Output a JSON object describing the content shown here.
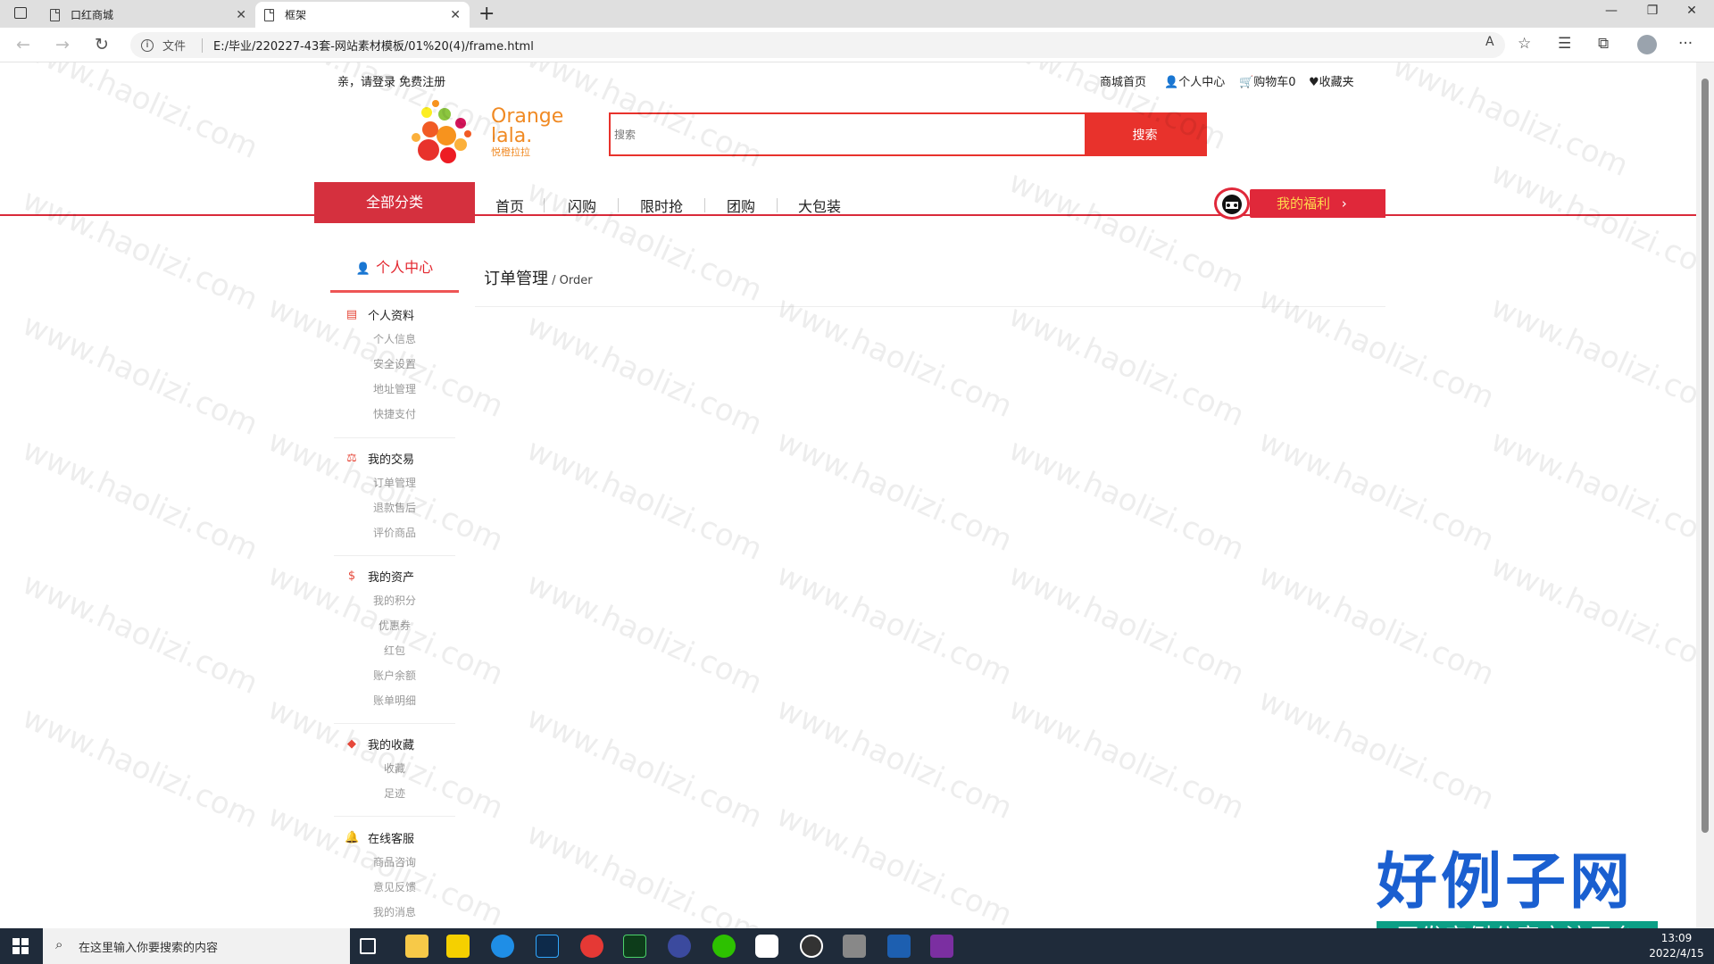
{
  "browser": {
    "tabs": [
      {
        "label": "口红商城"
      },
      {
        "label": "框架"
      }
    ],
    "file_label": "文件",
    "url": "E:/毕业/220227-43套-网站素材模板/01%20(4)/frame.html"
  },
  "topbar": {
    "login_text": "亲，请登录 免费注册",
    "links": [
      "商城首页",
      "个人中心",
      "购物车0",
      "收藏夹"
    ]
  },
  "logo": {
    "line1": "Orange",
    "line2": "lala.",
    "sub": "悦橙拉拉"
  },
  "search": {
    "placeholder": "搜索",
    "button": "搜索"
  },
  "nav": {
    "all_categories": "全部分类",
    "items": [
      "首页",
      "闪购",
      "限时抢",
      "团购",
      "大包装"
    ],
    "welfare": "我的福利"
  },
  "sidebar": {
    "title": "个人中心",
    "groups": [
      {
        "title": "个人资料",
        "icon": "id-card-icon",
        "items": [
          "个人信息",
          "安全设置",
          "地址管理",
          "快捷支付"
        ]
      },
      {
        "title": "我的交易",
        "icon": "scale-icon",
        "items": [
          "订单管理",
          "退款售后",
          "评价商品"
        ]
      },
      {
        "title": "我的资产",
        "icon": "dollar-icon",
        "items": [
          "我的积分",
          "优惠券",
          "红包",
          "账户余额",
          "账单明细"
        ]
      },
      {
        "title": "我的收藏",
        "icon": "tags-icon",
        "items": [
          "收藏",
          "足迹"
        ]
      },
      {
        "title": "在线客服",
        "icon": "bell-icon",
        "items": [
          "商品咨询",
          "意见反馈",
          "我的消息"
        ]
      }
    ]
  },
  "main": {
    "title": "订单管理",
    "subtitle": "/ Order"
  },
  "watermark_text": "www.haolizi.com",
  "brand": {
    "title": "好例子网",
    "tagline": "开发实例分享交流平台"
  },
  "taskbar": {
    "search_placeholder": "在这里输入你要搜索的内容",
    "time": "13:09",
    "date": "2022/4/15"
  },
  "colors": {
    "accent_red": "#e8322c",
    "nav_red": "#d5303e",
    "welfare_text": "#ffd84d"
  }
}
